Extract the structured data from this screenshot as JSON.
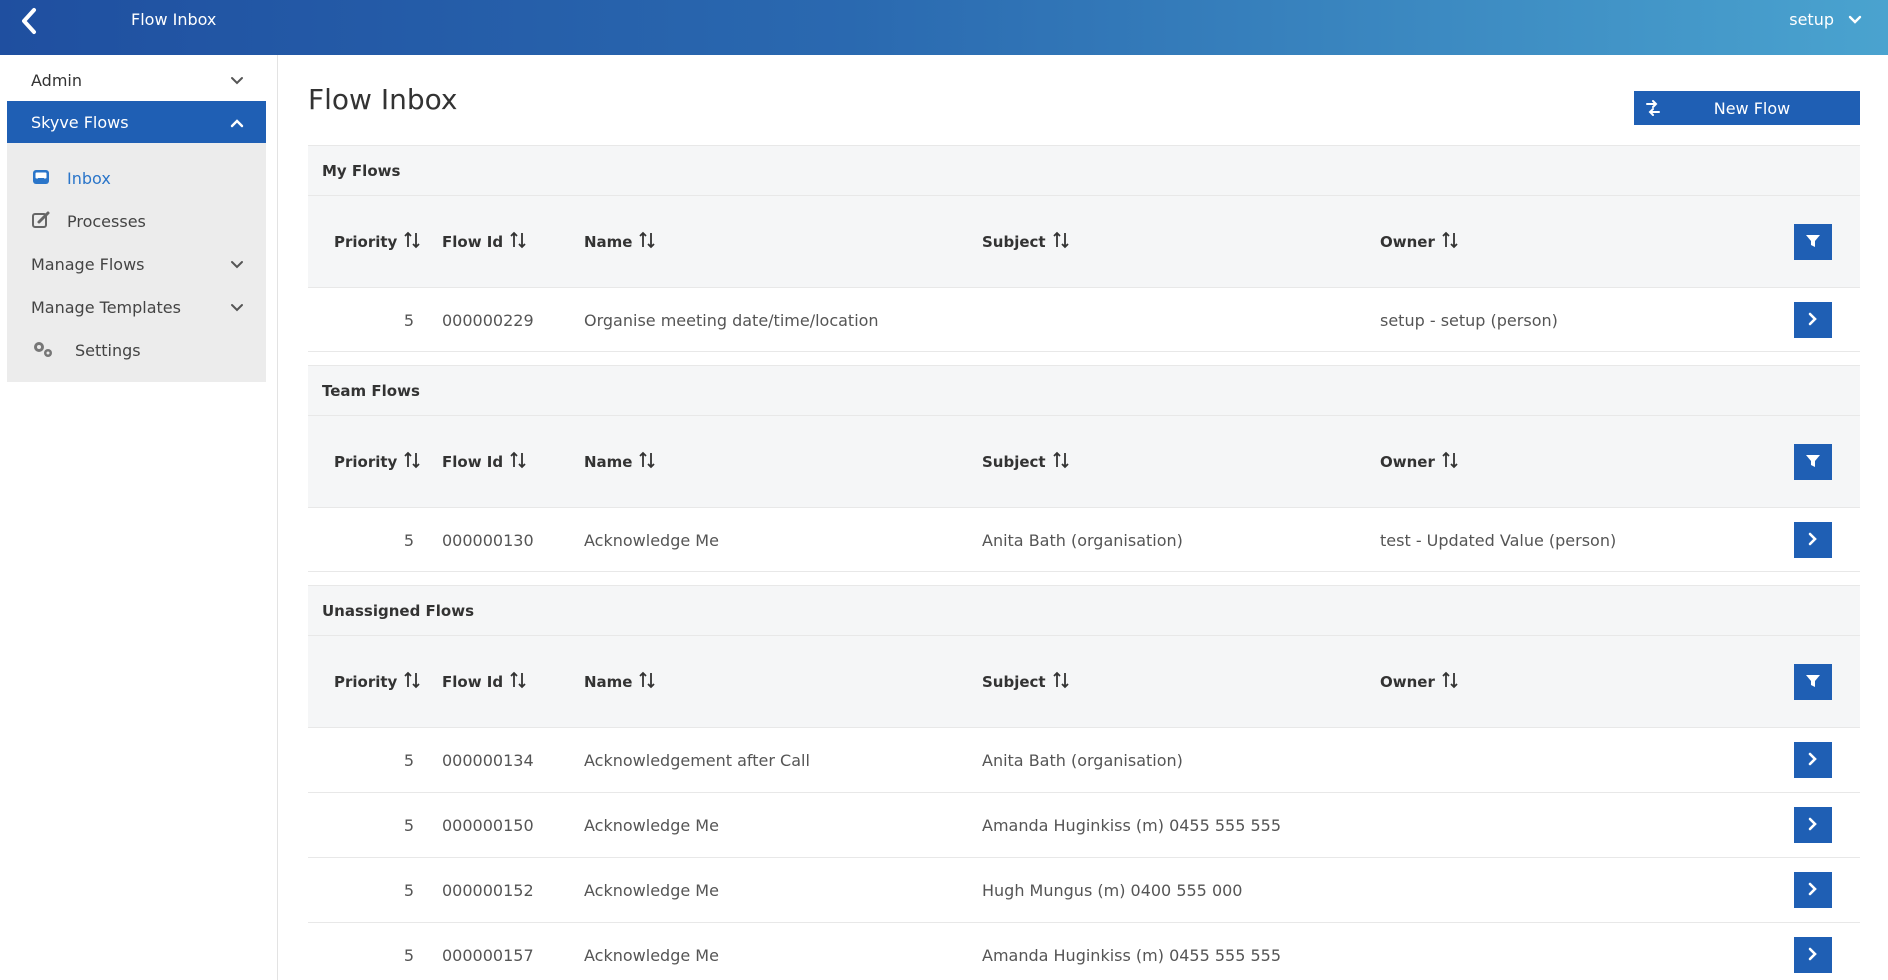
{
  "topbar": {
    "title": "Flow Inbox",
    "user": "setup"
  },
  "sidebar": {
    "admin_label": "Admin",
    "group_label": "Skyve Flows",
    "items": [
      {
        "label": "Inbox",
        "icon": "inbox-icon"
      },
      {
        "label": "Processes",
        "icon": "edit-icon"
      },
      {
        "label": "Manage Flows",
        "icon": "chevron-down-icon"
      },
      {
        "label": "Manage Templates",
        "icon": "chevron-down-icon"
      },
      {
        "label": "Settings",
        "icon": "gears-icon"
      }
    ]
  },
  "main": {
    "title": "Flow Inbox",
    "new_flow_label": "New Flow",
    "columns": [
      "Priority",
      "Flow Id",
      "Name",
      "Subject",
      "Owner"
    ],
    "sections": [
      {
        "title": "My Flows",
        "rows": [
          {
            "priority": "5",
            "flow_id": "000000229",
            "name": "Organise meeting date/time/location",
            "subject": "",
            "owner": "setup - setup (person)"
          }
        ]
      },
      {
        "title": "Team Flows",
        "rows": [
          {
            "priority": "5",
            "flow_id": "000000130",
            "name": "Acknowledge Me",
            "subject": "Anita Bath (organisation)",
            "owner": "test - Updated Value (person)"
          }
        ]
      },
      {
        "title": "Unassigned Flows",
        "rows": [
          {
            "priority": "5",
            "flow_id": "000000134",
            "name": "Acknowledgement after Call",
            "subject": "Anita Bath (organisation)",
            "owner": ""
          },
          {
            "priority": "5",
            "flow_id": "000000150",
            "name": "Acknowledge Me",
            "subject": "Amanda Huginkiss (m) 0455 555 555",
            "owner": ""
          },
          {
            "priority": "5",
            "flow_id": "000000152",
            "name": "Acknowledge Me",
            "subject": "Hugh Mungus (m) 0400 555 000",
            "owner": ""
          },
          {
            "priority": "5",
            "flow_id": "000000157",
            "name": "Acknowledge Me",
            "subject": "Amanda Huginkiss (m) 0455 555 555",
            "owner": ""
          }
        ]
      }
    ]
  }
}
